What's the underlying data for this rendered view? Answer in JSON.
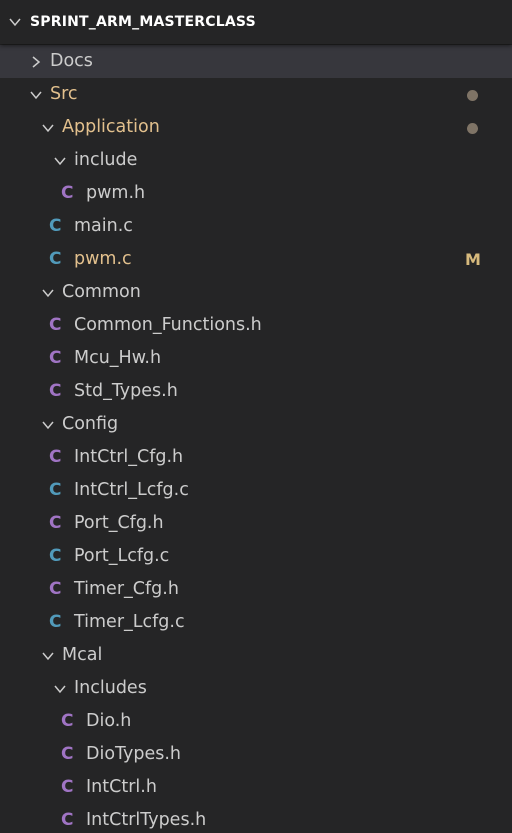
{
  "header": {
    "title": "SPRINT_ARM_MASTERCLASS"
  },
  "colors": {
    "background": "#252526",
    "selected_row": "#37373d",
    "text": "#cccccc",
    "modified_text": "#e2c08d",
    "modified_badge": "#d7ba7d",
    "h_icon": "#a074c4",
    "c_icon": "#519aba",
    "dot": "#7f7466"
  },
  "tree": [
    {
      "label": "Docs",
      "kind": "folder",
      "expanded": false,
      "depth": 0,
      "selected": true,
      "icon": "chevron-right-icon"
    },
    {
      "label": "Src",
      "kind": "folder",
      "expanded": true,
      "depth": 0,
      "modified": true,
      "dot": true,
      "icon": "chevron-down-icon"
    },
    {
      "label": "Application",
      "kind": "folder",
      "expanded": true,
      "depth": 1,
      "modified": true,
      "dot": true,
      "icon": "chevron-down-icon"
    },
    {
      "label": "include",
      "kind": "folder",
      "expanded": true,
      "depth": 2,
      "icon": "chevron-down-icon"
    },
    {
      "label": "pwm.h",
      "kind": "h",
      "depth": 3,
      "file_icon": "C"
    },
    {
      "label": "main.c",
      "kind": "c",
      "depth": 2,
      "file_icon": "C"
    },
    {
      "label": "pwm.c",
      "kind": "c",
      "depth": 2,
      "modified": true,
      "badge": "M",
      "file_icon": "C"
    },
    {
      "label": "Common",
      "kind": "folder",
      "expanded": true,
      "depth": 1,
      "icon": "chevron-down-icon"
    },
    {
      "label": "Common_Functions.h",
      "kind": "h",
      "depth": 2,
      "file_icon": "C"
    },
    {
      "label": "Mcu_Hw.h",
      "kind": "h",
      "depth": 2,
      "file_icon": "C"
    },
    {
      "label": "Std_Types.h",
      "kind": "h",
      "depth": 2,
      "file_icon": "C"
    },
    {
      "label": "Config",
      "kind": "folder",
      "expanded": true,
      "depth": 1,
      "icon": "chevron-down-icon"
    },
    {
      "label": "IntCtrl_Cfg.h",
      "kind": "h",
      "depth": 2,
      "file_icon": "C"
    },
    {
      "label": "IntCtrl_Lcfg.c",
      "kind": "c",
      "depth": 2,
      "file_icon": "C"
    },
    {
      "label": "Port_Cfg.h",
      "kind": "h",
      "depth": 2,
      "file_icon": "C"
    },
    {
      "label": "Port_Lcfg.c",
      "kind": "c",
      "depth": 2,
      "file_icon": "C"
    },
    {
      "label": "Timer_Cfg.h",
      "kind": "h",
      "depth": 2,
      "file_icon": "C"
    },
    {
      "label": "Timer_Lcfg.c",
      "kind": "c",
      "depth": 2,
      "file_icon": "C"
    },
    {
      "label": "Mcal",
      "kind": "folder",
      "expanded": true,
      "depth": 1,
      "icon": "chevron-down-icon"
    },
    {
      "label": "Includes",
      "kind": "folder",
      "expanded": true,
      "depth": 2,
      "icon": "chevron-down-icon"
    },
    {
      "label": "Dio.h",
      "kind": "h",
      "depth": 3,
      "file_icon": "C"
    },
    {
      "label": "DioTypes.h",
      "kind": "h",
      "depth": 3,
      "file_icon": "C"
    },
    {
      "label": "IntCtrl.h",
      "kind": "h",
      "depth": 3,
      "file_icon": "C"
    },
    {
      "label": "IntCtrlTypes.h",
      "kind": "h",
      "depth": 3,
      "file_icon": "C"
    }
  ]
}
